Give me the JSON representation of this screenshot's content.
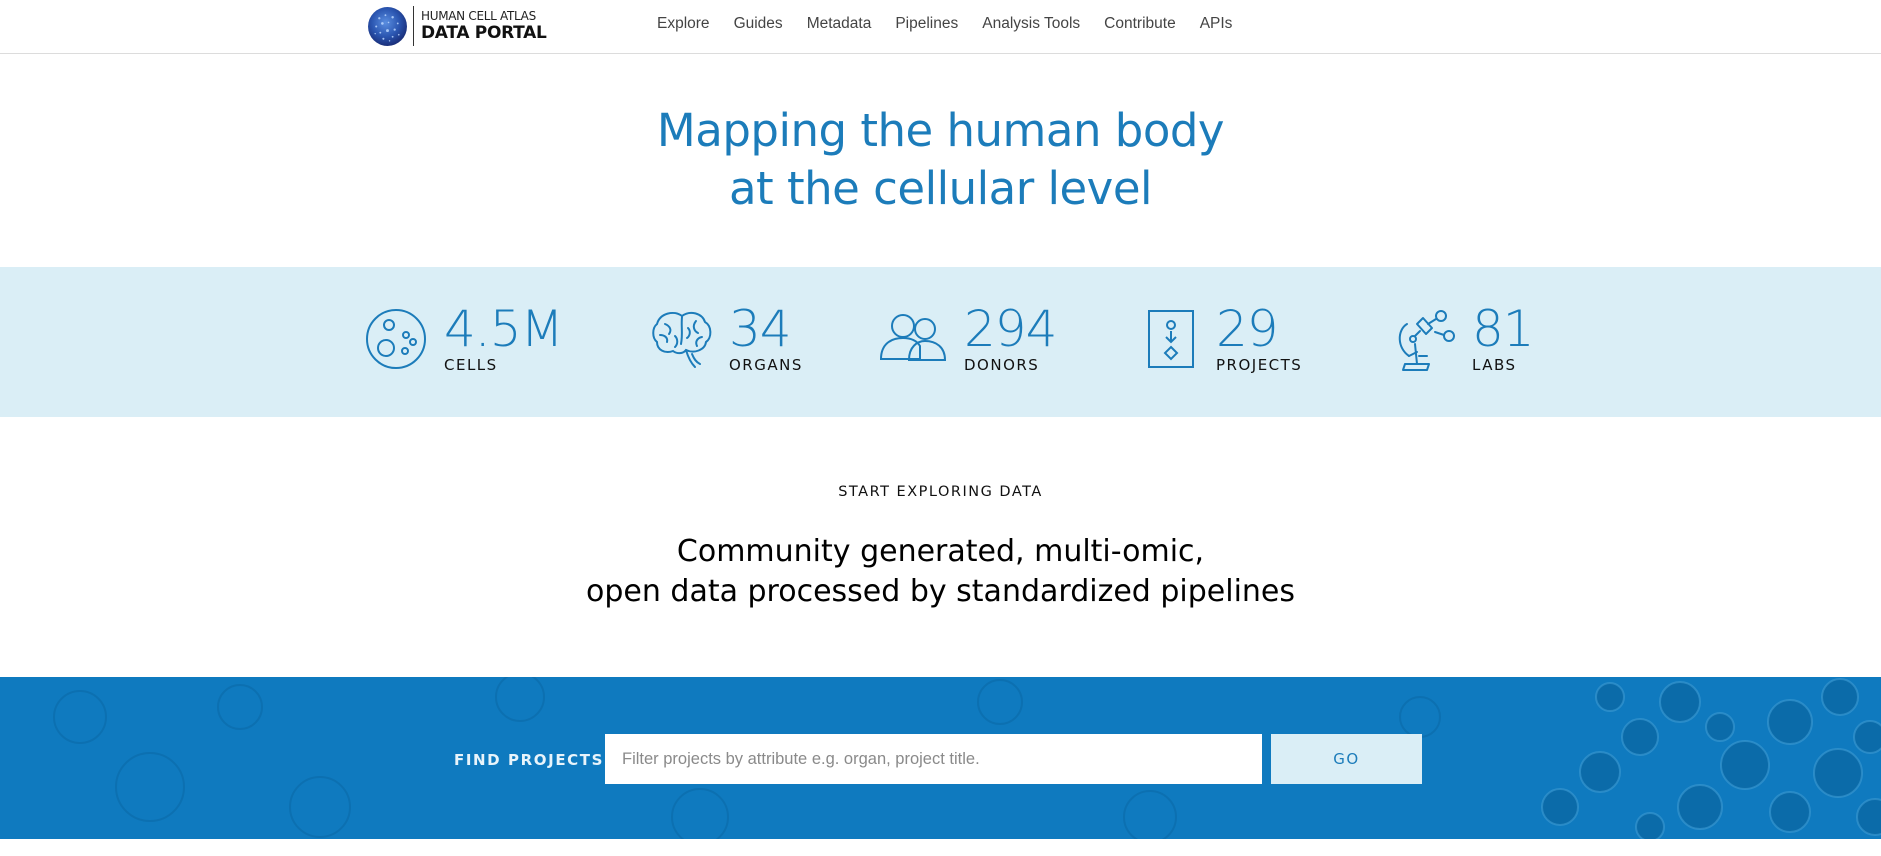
{
  "header": {
    "logo_line1": "HUMAN CELL ATLAS",
    "logo_line2": "DATA PORTAL",
    "nav": [
      "Explore",
      "Guides",
      "Metadata",
      "Pipelines",
      "Analysis Tools",
      "Contribute",
      "APIs"
    ]
  },
  "hero": {
    "line1": "Mapping the human body",
    "line2": "at the cellular level"
  },
  "stats": [
    {
      "value": "4.5M",
      "label": "CELLS",
      "icon": "cells-icon"
    },
    {
      "value": "34",
      "label": "ORGANS",
      "icon": "brain-icon"
    },
    {
      "value": "294",
      "label": "DONORS",
      "icon": "donors-icon"
    },
    {
      "value": "29",
      "label": "PROJECTS",
      "icon": "projects-icon"
    },
    {
      "value": "81",
      "label": "LABS",
      "icon": "microscope-icon"
    }
  ],
  "explore": {
    "eyebrow": "START EXPLORING DATA",
    "tagline1": "Community generated, multi-omic,",
    "tagline2": "open data processed by standardized pipelines"
  },
  "find": {
    "label": "FIND PROJECTS",
    "placeholder": "Filter projects by attribute e.g. organ, project title.",
    "value": "",
    "button": "GO"
  },
  "colors": {
    "accent": "#1c7cba",
    "stats_band": "#daeef6",
    "find_band": "#0f7abf"
  }
}
